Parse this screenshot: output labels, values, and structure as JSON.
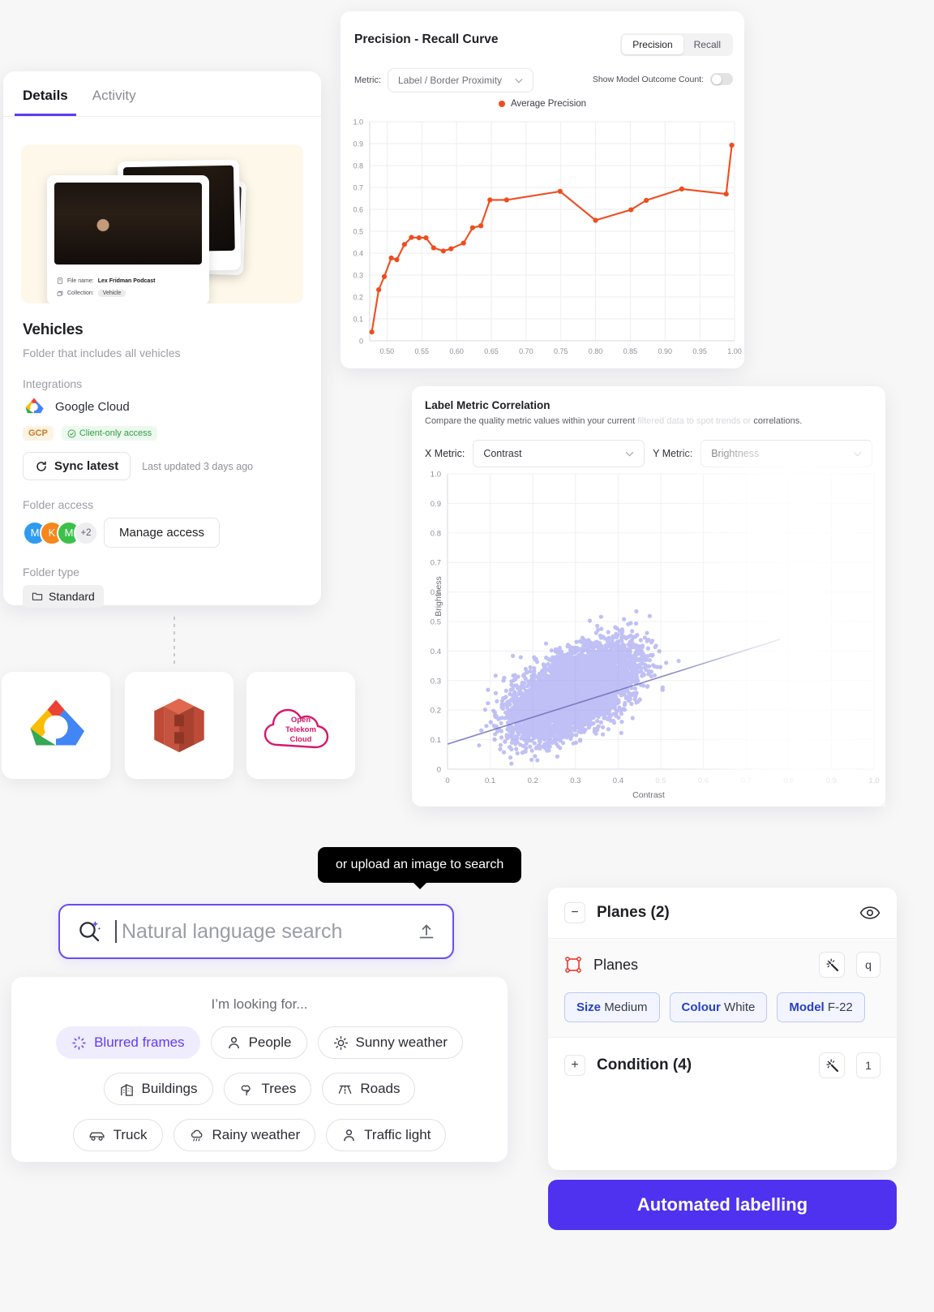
{
  "details": {
    "tabs": [
      {
        "label": "Details",
        "active": true
      },
      {
        "label": "Activity",
        "active": false
      }
    ],
    "thumbnail": {
      "file_name_label": "File name:",
      "file_name_value": "Lex Fridman Podcast",
      "collection_label": "Collection:",
      "collection_value": "Vehicle"
    },
    "folder_title": "Vehicles",
    "folder_description": "Folder that includes all vehicles",
    "integrations_label": "Integrations",
    "integration_name": "Google Cloud",
    "badge_provider": "GCP",
    "badge_access": "Client-only access",
    "sync_button": "Sync latest",
    "sync_updated": "Last updated 3 days ago",
    "folder_access_label": "Folder access",
    "avatars": [
      "M",
      "K",
      "M"
    ],
    "avatar_more": "+2",
    "manage_access": "Manage access",
    "folder_type_label": "Folder type",
    "folder_type_value": "Standard"
  },
  "logo_cards": [
    {
      "name": "Google Cloud"
    },
    {
      "name": "AWS S3"
    },
    {
      "name": "Open Telekom Cloud",
      "line1": "Open",
      "line2": "Telekom",
      "line3": "Cloud"
    }
  ],
  "pr_card": {
    "title": "Precision - Recall Curve",
    "segments": [
      {
        "label": "Precision",
        "active": true
      },
      {
        "label": "Recall",
        "active": false
      }
    ],
    "metric_label": "Metric:",
    "metric_value": "Label / Border Proximity",
    "outcome_label": "Show Model Outcome Count:",
    "outcome_on": false,
    "legend": "Average Precision"
  },
  "corr_card": {
    "title": "Label Metric Correlation",
    "subtitle_a": "Compare the quality metric values within your current ",
    "subtitle_faded": "filtered data to spot trends or ",
    "subtitle_b": "correlations.",
    "x_metric_label": "X Metric:",
    "x_metric_value": "Contrast",
    "y_metric_label": "Y Metric:",
    "y_metric_value": "Brightness"
  },
  "search": {
    "tooltip": "or upload an image to search",
    "placeholder": "Natural language search",
    "value": ""
  },
  "suggestions": {
    "title": "I’m looking for...",
    "rows": [
      [
        {
          "label": "Blurred frames",
          "icon": "blur-icon",
          "selected": true
        },
        {
          "label": "People",
          "icon": "person-icon",
          "selected": false
        },
        {
          "label": "Sunny weather",
          "icon": "sun-icon",
          "selected": false
        }
      ],
      [
        {
          "label": "Buildings",
          "icon": "building-icon",
          "selected": false
        },
        {
          "label": "Trees",
          "icon": "tree-icon",
          "selected": false
        },
        {
          "label": "Roads",
          "icon": "road-icon",
          "selected": false
        }
      ],
      [
        {
          "label": "Truck",
          "icon": "truck-icon",
          "selected": false
        },
        {
          "label": "Rainy weather",
          "icon": "rain-icon",
          "selected": false
        },
        {
          "label": "Traffic light",
          "icon": "person-icon",
          "selected": false
        }
      ]
    ]
  },
  "label_panel": {
    "group_collapse": "−",
    "group_title": "Planes (2)",
    "item_name": "Planes",
    "item_shortcut": "q",
    "attributes": [
      {
        "key": "Size",
        "value": "Medium"
      },
      {
        "key": "Colour",
        "value": "White"
      },
      {
        "key": "Model",
        "value": "F-22"
      }
    ],
    "condition_expand": "+",
    "condition_title": "Condition (4)",
    "condition_count": "1",
    "automated_button": "Automated labelling"
  },
  "colors": {
    "accent": "#5b3df5",
    "pr_line": "#ee4d1f",
    "scatter": "#8e8ef0",
    "primary_button": "#4f31f0"
  },
  "chart_data": [
    {
      "type": "line",
      "title": "Precision - Recall Curve",
      "xlabel": "",
      "ylabel": "",
      "xlim": [
        0.475,
        1.0
      ],
      "ylim": [
        0,
        1.0
      ],
      "xticks": [
        0.5,
        0.55,
        0.6,
        0.65,
        0.7,
        0.75,
        0.8,
        0.85,
        0.9,
        0.95,
        1.0
      ],
      "yticks": [
        0,
        0.1,
        0.2,
        0.3,
        0.4,
        0.5,
        0.6,
        0.7,
        0.8,
        0.9,
        1.0
      ],
      "grid": true,
      "legend": [
        "Average Precision"
      ],
      "legend_position": "top-center",
      "series": [
        {
          "name": "Average Precision",
          "color": "#ee4d1f",
          "x": [
            0.478,
            0.488,
            0.496,
            0.506,
            0.514,
            0.525,
            0.535,
            0.546,
            0.556,
            0.567,
            0.581,
            0.592,
            0.61,
            0.623,
            0.635,
            0.648,
            0.672,
            0.749,
            0.8,
            0.851,
            0.873,
            0.924,
            0.988,
            0.996
          ],
          "y": [
            0.04,
            0.233,
            0.293,
            0.378,
            0.37,
            0.44,
            0.472,
            0.47,
            0.47,
            0.424,
            0.41,
            0.42,
            0.446,
            0.516,
            0.525,
            0.643,
            0.643,
            0.682,
            0.55,
            0.598,
            0.641,
            0.693,
            0.67,
            0.893
          ]
        }
      ]
    },
    {
      "type": "scatter",
      "title": "Label Metric Correlation",
      "xlabel": "Contrast",
      "ylabel": "Brightness",
      "xlim": [
        0,
        1.0
      ],
      "ylim": [
        0,
        1.0
      ],
      "xticks": [
        0,
        0.1,
        0.2,
        0.3,
        0.4,
        0.5,
        0.6,
        0.7,
        0.8,
        0.9,
        1.0
      ],
      "yticks": [
        0,
        0.1,
        0.2,
        0.3,
        0.4,
        0.5,
        0.6,
        0.7,
        0.8,
        0.9,
        1.0
      ],
      "grid": true,
      "point_color": "#8e8ef0",
      "n_points": 6000,
      "correlation": "positive",
      "trendline": {
        "x0": 0.0,
        "y0": 0.085,
        "x1": 0.78,
        "y1": 0.44,
        "color": "#6b6bb8"
      },
      "cluster": {
        "x_mean": 0.3,
        "x_sd": 0.12,
        "y_mean": 0.27,
        "y_sd": 0.13,
        "note": "dense positively-correlated cloud, main mass 0.05-0.55 contrast"
      }
    }
  ]
}
